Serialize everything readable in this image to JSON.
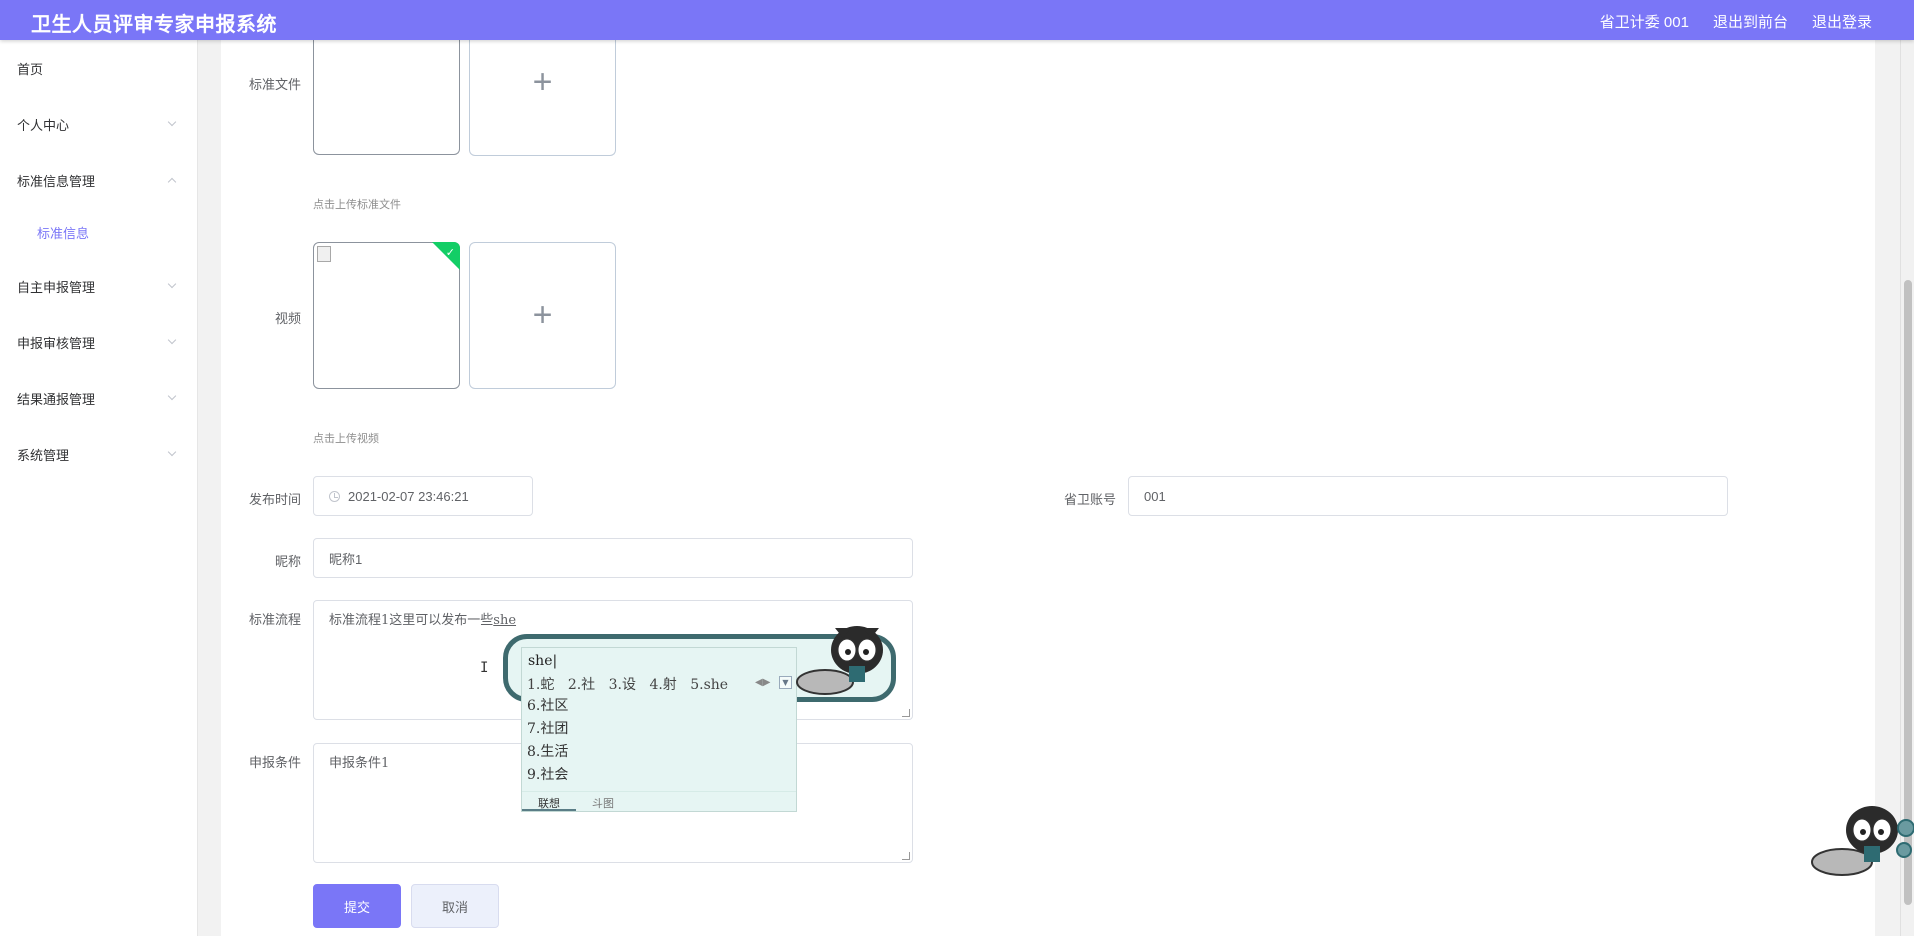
{
  "header": {
    "title": "卫生人员评审专家申报系统",
    "account": "省卫计委 001",
    "to_front": "退出到前台",
    "logout": "退出登录"
  },
  "sidebar": {
    "items": [
      {
        "label": "首页"
      },
      {
        "label": "个人中心"
      },
      {
        "label": "标准信息管理"
      },
      {
        "label": "标准信息"
      },
      {
        "label": "自主申报管理"
      },
      {
        "label": "申报审核管理"
      },
      {
        "label": "结果通报管理"
      },
      {
        "label": "系统管理"
      }
    ]
  },
  "form": {
    "std_file_label": "标准文件",
    "std_file_tip": "点击上传标准文件",
    "video_label": "视频",
    "video_tip": "点击上传视频",
    "publish_time_label": "发布时间",
    "publish_time_value": "2021-02-07 23:46:21",
    "account_label": "省卫账号",
    "account_value": "001",
    "nickname_label": "昵称",
    "nickname_value": "昵称1",
    "process_label": "标准流程",
    "process_value": "标准流程1这里可以发布一些",
    "process_typed": "she",
    "condition_label": "申报条件",
    "condition_value": "申报条件1",
    "submit_label": "提交",
    "cancel_label": "取消"
  },
  "ime": {
    "composition": "she",
    "candidates": [
      "1.蛇",
      "2.社",
      "3.设",
      "4.射",
      "5.she"
    ],
    "list": [
      "6.社区",
      "7.社团",
      "8.生活",
      "9.社会"
    ],
    "tabs": [
      "联想",
      "斗图"
    ]
  }
}
